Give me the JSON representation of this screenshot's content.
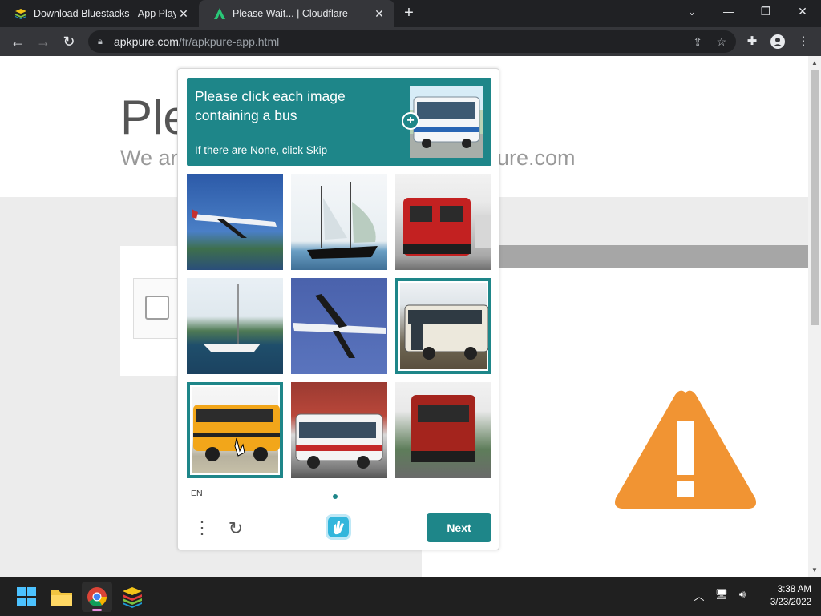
{
  "browser": {
    "tabs": [
      {
        "title": "Download Bluestacks - App Player",
        "icon": "bluestacks-icon"
      },
      {
        "title": "Please Wait... | Cloudflare",
        "icon": "apkpure-icon",
        "active": true
      }
    ],
    "new_tab": "+",
    "window_controls": {
      "dropdown": "⌄",
      "minimize": "—",
      "restore": "❐",
      "close": "✕"
    },
    "url_host": "apkpure.com",
    "url_path": "/fr/apkpure-app.html",
    "nav": {
      "back": "←",
      "forward": "→",
      "reload": "↻"
    }
  },
  "page": {
    "title": "Ple",
    "subtitle_start": "We ar",
    "subtitle_end": "ure.com"
  },
  "captcha": {
    "prompt": "Please click each image containing a bus",
    "hint": "If there are None, click Skip",
    "add": "+",
    "language": "EN",
    "next_label": "Next",
    "menu": "⋮",
    "refresh": "↻",
    "accent": "#1e8689",
    "cells": [
      {
        "name": "airplane-image",
        "selected": false
      },
      {
        "name": "sailboat-image",
        "selected": false
      },
      {
        "name": "train-image",
        "selected": false
      },
      {
        "name": "sailboat-image",
        "selected": false
      },
      {
        "name": "airplane-image",
        "selected": false
      },
      {
        "name": "bus-image",
        "selected": true
      },
      {
        "name": "school-bus-image",
        "selected": true
      },
      {
        "name": "bus-image",
        "selected": false
      },
      {
        "name": "train-image",
        "selected": false
      }
    ]
  },
  "taskbar": {
    "apps": [
      "windows-start-icon",
      "file-explorer-icon",
      "chrome-icon",
      "bluestacks-icon"
    ],
    "time": "3:38 AM",
    "date": "3/23/2022"
  }
}
